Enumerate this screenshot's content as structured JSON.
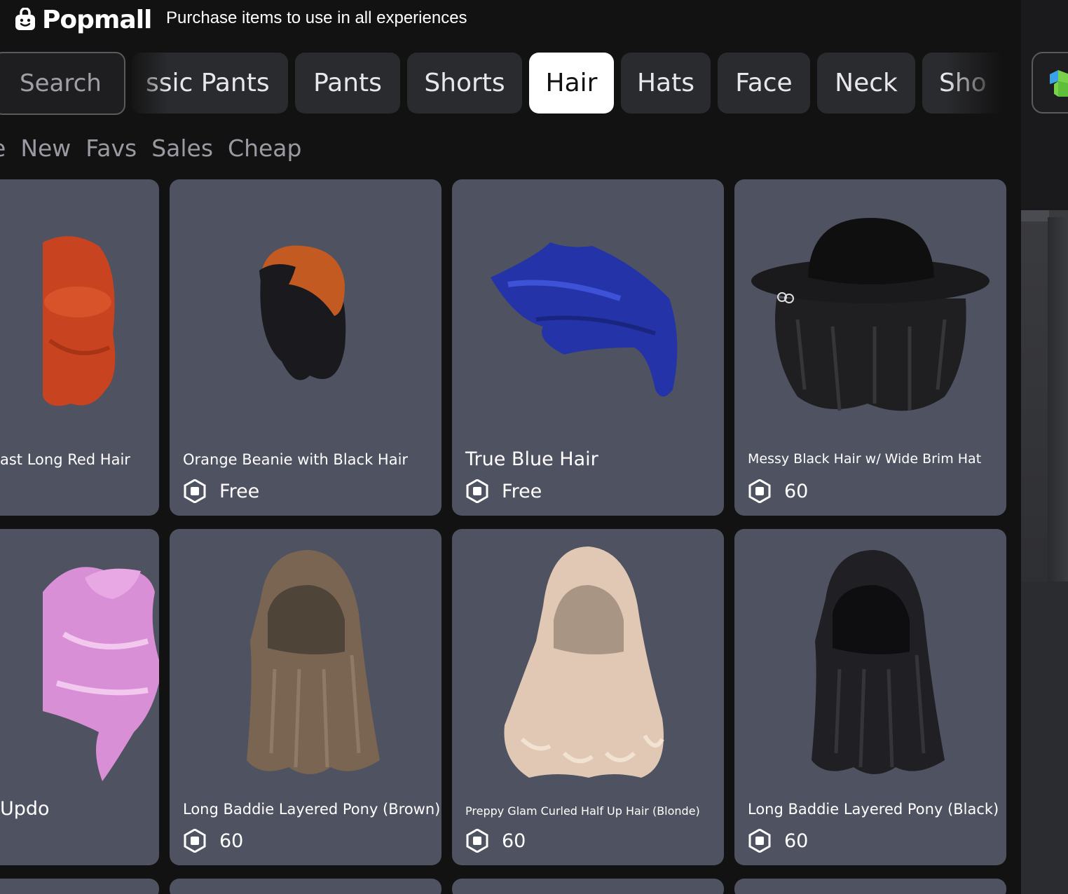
{
  "header": {
    "app_name": "Popmall",
    "tagline": "Purchase items to use in all experiences"
  },
  "search": {
    "placeholder": "Search"
  },
  "tabs": [
    {
      "label": "ssic Pants"
    },
    {
      "label": "Pants"
    },
    {
      "label": "Shorts"
    },
    {
      "label": "Hair",
      "active": true
    },
    {
      "label": "Hats"
    },
    {
      "label": "Face"
    },
    {
      "label": "Neck"
    },
    {
      "label": "Sho"
    }
  ],
  "sorts": [
    "e",
    "New",
    "Favs",
    "Sales",
    "Cheap"
  ],
  "items": [
    {
      "name": "ast Long Red Hair",
      "price": "",
      "hair_color": "#c8431f"
    },
    {
      "name": "Orange Beanie with Black Hair",
      "price": "Free",
      "hair_color": "#1a1a1e",
      "accent_color": "#c35a22"
    },
    {
      "name": "True Blue Hair",
      "price": "Free",
      "hair_color": "#2434a8"
    },
    {
      "name": "Messy Black Hair w/ Wide Brim Hat",
      "price": "60",
      "hair_color": "#1f1f22"
    },
    {
      "name": "Updo",
      "price": "",
      "hair_color": "#d98fd6"
    },
    {
      "name": "Long Baddie Layered Pony (Brown)",
      "price": "60",
      "hair_color": "#7a6553"
    },
    {
      "name": "Preppy Glam Curled Half Up Hair (Blonde)",
      "price": "60",
      "hair_color": "#e0c8b4"
    },
    {
      "name": "Long Baddie Layered Pony (Black)",
      "price": "60",
      "hair_color": "#202024"
    }
  ],
  "colors": {
    "background": "#121212",
    "card": "#4f5260",
    "tab": "#2a2b2e",
    "tab_active": "#ffffff",
    "muted_text": "#9a9aa2"
  }
}
